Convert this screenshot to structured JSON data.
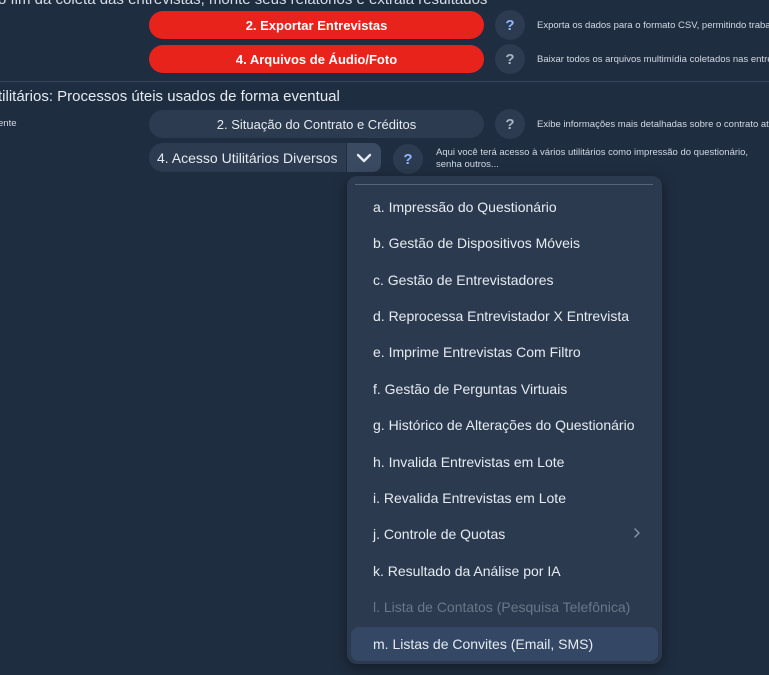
{
  "top_text": "o fim da coleta das entrevistas, monte seus relatórios e extraia resultados",
  "export_rows": [
    {
      "label": "2. Exportar Entrevistas",
      "help": "?",
      "desc": "Exporta os dados para o formato CSV, permitindo trabalh"
    },
    {
      "label": "4. Arquivos de Áudio/Foto",
      "help": "?",
      "desc": "Baixar todos os arquivos multimídia coletados nas entre"
    }
  ],
  "section_title": "tilitários: Processos úteis usados de forma eventual",
  "left_fragment": "ente",
  "contract_row": {
    "label": "2. Situação do Contrato e Créditos",
    "help": "?",
    "desc": "Exibe informações mais detalhadas sobre o contrato atu"
  },
  "utilities_select": {
    "value": "4. Acesso Utilitários Diversos",
    "help": "?",
    "desc": "Aqui você terá acesso à vários utilitários como impressão do questionário, senha outros..."
  },
  "menu_items": [
    {
      "label": "a. Impressão do Questionário"
    },
    {
      "label": "b. Gestão de Dispositivos Móveis"
    },
    {
      "label": "c. Gestão de Entrevistadores"
    },
    {
      "label": "d. Reprocessa Entrevistador X Entrevista"
    },
    {
      "label": "e. Imprime Entrevistas Com Filtro"
    },
    {
      "label": "f. Gestão de Perguntas Virtuais"
    },
    {
      "label": "g. Histórico de Alterações do Questionário"
    },
    {
      "label": "h. Invalida Entrevistas em Lote"
    },
    {
      "label": "i. Revalida Entrevistas em Lote"
    },
    {
      "label": "j. Controle de Quotas"
    },
    {
      "label": "k. Resultado da Análise por IA"
    },
    {
      "label": "l. Lista de Contatos (Pesquisa Telefônica)"
    },
    {
      "label": "m. Listas de Convites (Email, SMS)"
    }
  ],
  "icons": {
    "help": "question-icon",
    "dropdown": "chevron-down-icon",
    "submenu": "chevron-right-icon"
  },
  "colors": {
    "accent_red": "#e8231c",
    "background": "#1f2d40",
    "menu_bg": "#2b3a4e"
  }
}
